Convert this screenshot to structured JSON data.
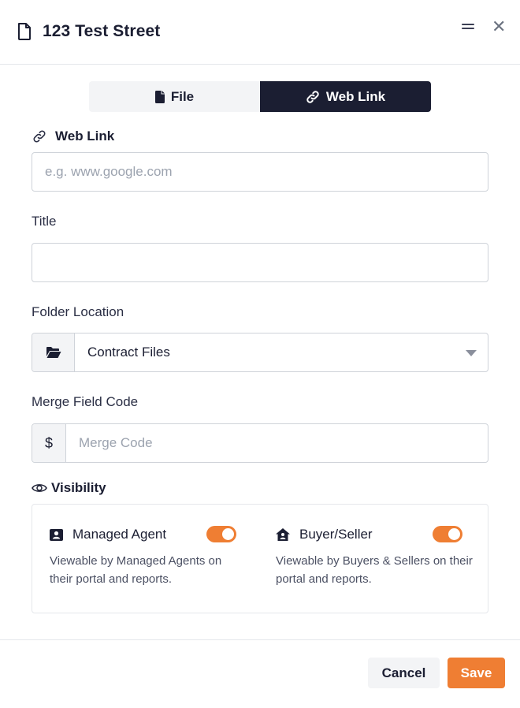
{
  "header": {
    "title": "123 Test Street",
    "icons": {
      "document": "document-icon",
      "minimize": "minimize-icon",
      "close": "close-icon"
    },
    "close_glyph": "✕"
  },
  "source_toggle": {
    "file_label": "File",
    "weblink_label": "Web Link",
    "active": "Web Link"
  },
  "form": {
    "web_link": {
      "label": "Web Link",
      "placeholder": "e.g. www.google.com",
      "value": ""
    },
    "title": {
      "label": "Title",
      "value": ""
    },
    "folder_location": {
      "label": "Folder Location",
      "selected": "Contract Files"
    },
    "merge_field": {
      "label": "Merge Field Code",
      "addon": "$",
      "placeholder": "Merge Code",
      "value": ""
    }
  },
  "visibility": {
    "label": "Visibility",
    "managed_agent": {
      "name": "Managed Agent",
      "description": "Viewable by Managed Agents on their portal and reports.",
      "enabled": true
    },
    "buyer_seller": {
      "name": "Buyer/Seller",
      "description": "Viewable by Buyers & Sellers on their portal and reports.",
      "enabled": true
    }
  },
  "footer": {
    "cancel_label": "Cancel",
    "save_label": "Save"
  },
  "colors": {
    "primary_dark": "#1b1e32",
    "accent_orange": "#ef7e33",
    "border": "#cfd3d9",
    "muted_bg": "#f3f4f6"
  }
}
